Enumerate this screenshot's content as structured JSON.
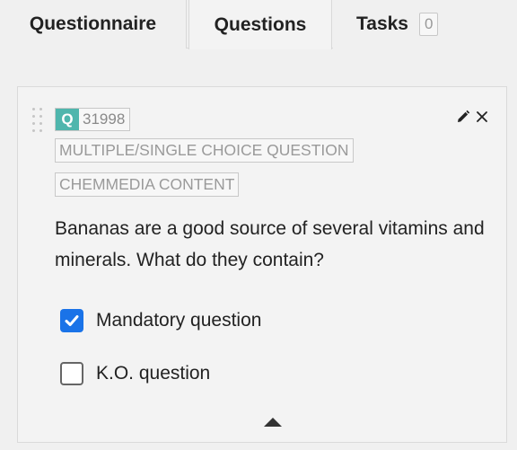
{
  "tabs": {
    "questionnaire": "Questionnaire",
    "questions": "Questions",
    "tasks": "Tasks",
    "tasks_count": "0"
  },
  "question": {
    "type_letter": "Q",
    "id": "31998",
    "type_tag": "MULTIPLE/SINGLE CHOICE QUESTION",
    "content_tag": "CHEMMEDIA CONTENT",
    "text": "Bananas are a good source of several vitamins and minerals. What do they contain?",
    "options": [
      {
        "label": "Mandatory question",
        "checked": true
      },
      {
        "label": "K.O. question",
        "checked": false
      }
    ]
  },
  "colors": {
    "accent_teal": "#4fb6ad",
    "checkbox_blue": "#1a73e8"
  },
  "icons": [
    "drag-handle-icon",
    "pencil-icon",
    "close-icon",
    "collapse-arrow-icon"
  ]
}
